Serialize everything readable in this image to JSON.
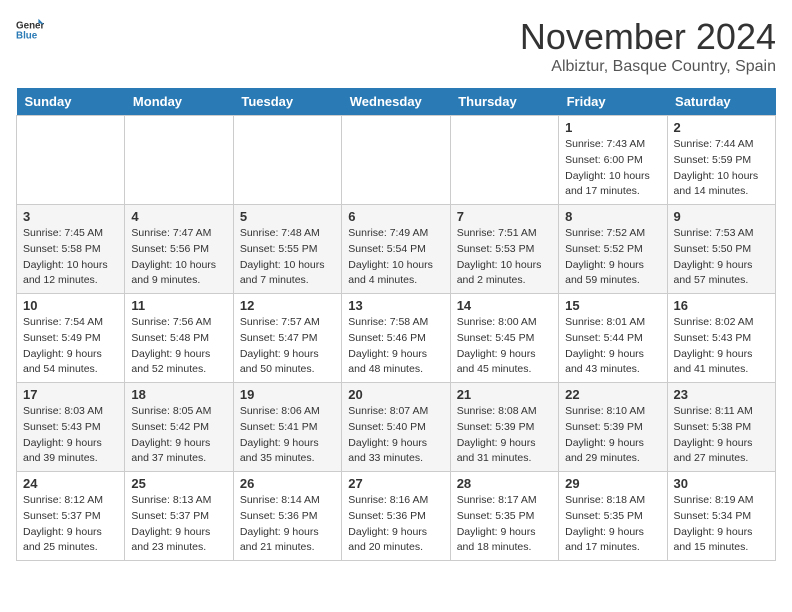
{
  "logo": {
    "general": "General",
    "blue": "Blue"
  },
  "title": "November 2024",
  "location": "Albiztur, Basque Country, Spain",
  "days_header": [
    "Sunday",
    "Monday",
    "Tuesday",
    "Wednesday",
    "Thursday",
    "Friday",
    "Saturday"
  ],
  "weeks": [
    [
      {
        "day": "",
        "info": ""
      },
      {
        "day": "",
        "info": ""
      },
      {
        "day": "",
        "info": ""
      },
      {
        "day": "",
        "info": ""
      },
      {
        "day": "",
        "info": ""
      },
      {
        "day": "1",
        "info": "Sunrise: 7:43 AM\nSunset: 6:00 PM\nDaylight: 10 hours and 17 minutes."
      },
      {
        "day": "2",
        "info": "Sunrise: 7:44 AM\nSunset: 5:59 PM\nDaylight: 10 hours and 14 minutes."
      }
    ],
    [
      {
        "day": "3",
        "info": "Sunrise: 7:45 AM\nSunset: 5:58 PM\nDaylight: 10 hours and 12 minutes."
      },
      {
        "day": "4",
        "info": "Sunrise: 7:47 AM\nSunset: 5:56 PM\nDaylight: 10 hours and 9 minutes."
      },
      {
        "day": "5",
        "info": "Sunrise: 7:48 AM\nSunset: 5:55 PM\nDaylight: 10 hours and 7 minutes."
      },
      {
        "day": "6",
        "info": "Sunrise: 7:49 AM\nSunset: 5:54 PM\nDaylight: 10 hours and 4 minutes."
      },
      {
        "day": "7",
        "info": "Sunrise: 7:51 AM\nSunset: 5:53 PM\nDaylight: 10 hours and 2 minutes."
      },
      {
        "day": "8",
        "info": "Sunrise: 7:52 AM\nSunset: 5:52 PM\nDaylight: 9 hours and 59 minutes."
      },
      {
        "day": "9",
        "info": "Sunrise: 7:53 AM\nSunset: 5:50 PM\nDaylight: 9 hours and 57 minutes."
      }
    ],
    [
      {
        "day": "10",
        "info": "Sunrise: 7:54 AM\nSunset: 5:49 PM\nDaylight: 9 hours and 54 minutes."
      },
      {
        "day": "11",
        "info": "Sunrise: 7:56 AM\nSunset: 5:48 PM\nDaylight: 9 hours and 52 minutes."
      },
      {
        "day": "12",
        "info": "Sunrise: 7:57 AM\nSunset: 5:47 PM\nDaylight: 9 hours and 50 minutes."
      },
      {
        "day": "13",
        "info": "Sunrise: 7:58 AM\nSunset: 5:46 PM\nDaylight: 9 hours and 48 minutes."
      },
      {
        "day": "14",
        "info": "Sunrise: 8:00 AM\nSunset: 5:45 PM\nDaylight: 9 hours and 45 minutes."
      },
      {
        "day": "15",
        "info": "Sunrise: 8:01 AM\nSunset: 5:44 PM\nDaylight: 9 hours and 43 minutes."
      },
      {
        "day": "16",
        "info": "Sunrise: 8:02 AM\nSunset: 5:43 PM\nDaylight: 9 hours and 41 minutes."
      }
    ],
    [
      {
        "day": "17",
        "info": "Sunrise: 8:03 AM\nSunset: 5:43 PM\nDaylight: 9 hours and 39 minutes."
      },
      {
        "day": "18",
        "info": "Sunrise: 8:05 AM\nSunset: 5:42 PM\nDaylight: 9 hours and 37 minutes."
      },
      {
        "day": "19",
        "info": "Sunrise: 8:06 AM\nSunset: 5:41 PM\nDaylight: 9 hours and 35 minutes."
      },
      {
        "day": "20",
        "info": "Sunrise: 8:07 AM\nSunset: 5:40 PM\nDaylight: 9 hours and 33 minutes."
      },
      {
        "day": "21",
        "info": "Sunrise: 8:08 AM\nSunset: 5:39 PM\nDaylight: 9 hours and 31 minutes."
      },
      {
        "day": "22",
        "info": "Sunrise: 8:10 AM\nSunset: 5:39 PM\nDaylight: 9 hours and 29 minutes."
      },
      {
        "day": "23",
        "info": "Sunrise: 8:11 AM\nSunset: 5:38 PM\nDaylight: 9 hours and 27 minutes."
      }
    ],
    [
      {
        "day": "24",
        "info": "Sunrise: 8:12 AM\nSunset: 5:37 PM\nDaylight: 9 hours and 25 minutes."
      },
      {
        "day": "25",
        "info": "Sunrise: 8:13 AM\nSunset: 5:37 PM\nDaylight: 9 hours and 23 minutes."
      },
      {
        "day": "26",
        "info": "Sunrise: 8:14 AM\nSunset: 5:36 PM\nDaylight: 9 hours and 21 minutes."
      },
      {
        "day": "27",
        "info": "Sunrise: 8:16 AM\nSunset: 5:36 PM\nDaylight: 9 hours and 20 minutes."
      },
      {
        "day": "28",
        "info": "Sunrise: 8:17 AM\nSunset: 5:35 PM\nDaylight: 9 hours and 18 minutes."
      },
      {
        "day": "29",
        "info": "Sunrise: 8:18 AM\nSunset: 5:35 PM\nDaylight: 9 hours and 17 minutes."
      },
      {
        "day": "30",
        "info": "Sunrise: 8:19 AM\nSunset: 5:34 PM\nDaylight: 9 hours and 15 minutes."
      }
    ]
  ]
}
